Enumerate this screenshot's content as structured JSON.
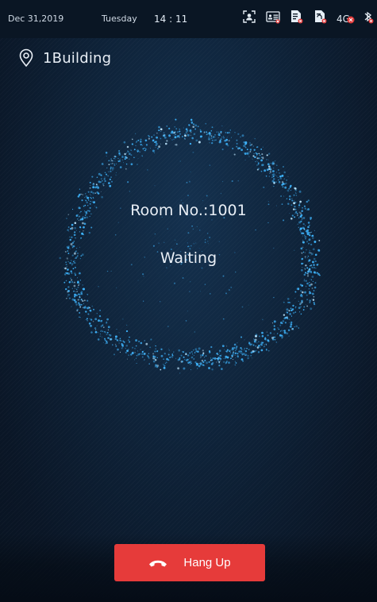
{
  "status_bar": {
    "date": "Dec 31,2019",
    "weekday": "Tuesday",
    "time": "14 : 11",
    "network_label": "4G",
    "icons": [
      "face-id-icon",
      "id-card-icon",
      "card-disabled-icon",
      "fingerprint-disabled-icon",
      "network-4g-icon",
      "bluetooth-disabled-icon"
    ]
  },
  "location": {
    "icon": "location-pin-icon",
    "label": "1Building"
  },
  "call": {
    "room_label": "Room No.:1001",
    "status": "Waiting"
  },
  "hangup_button": {
    "icon": "phone-hangup-icon",
    "label": "Hang Up"
  },
  "colors": {
    "accent_red": "#e63b3a",
    "ring_blue": "#3fb6ff",
    "background": "#0c1a2c"
  }
}
